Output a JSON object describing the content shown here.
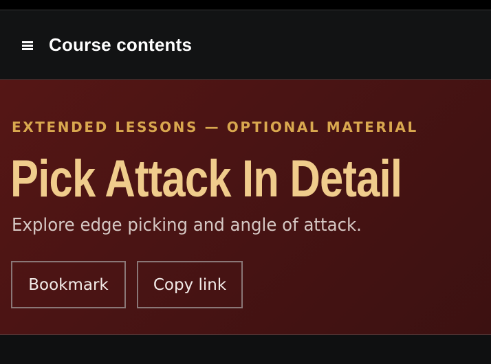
{
  "navbar": {
    "title": "Course contents",
    "menu_icon": "hamburger-menu-icon"
  },
  "hero": {
    "eyebrow": "EXTENDED LESSONS — OPTIONAL MATERIAL",
    "title": "Pick Attack In Detail",
    "subtitle": "Explore edge picking and angle of attack.",
    "buttons": {
      "bookmark": "Bookmark",
      "copy_link": "Copy link"
    }
  },
  "colors": {
    "navbar_bg": "#121314",
    "hero_bg": "#4a1414",
    "eyebrow": "#d9a84f",
    "title": "#f0cc8c",
    "subtitle": "#d6c8c4",
    "button_border": "#8a7777"
  }
}
